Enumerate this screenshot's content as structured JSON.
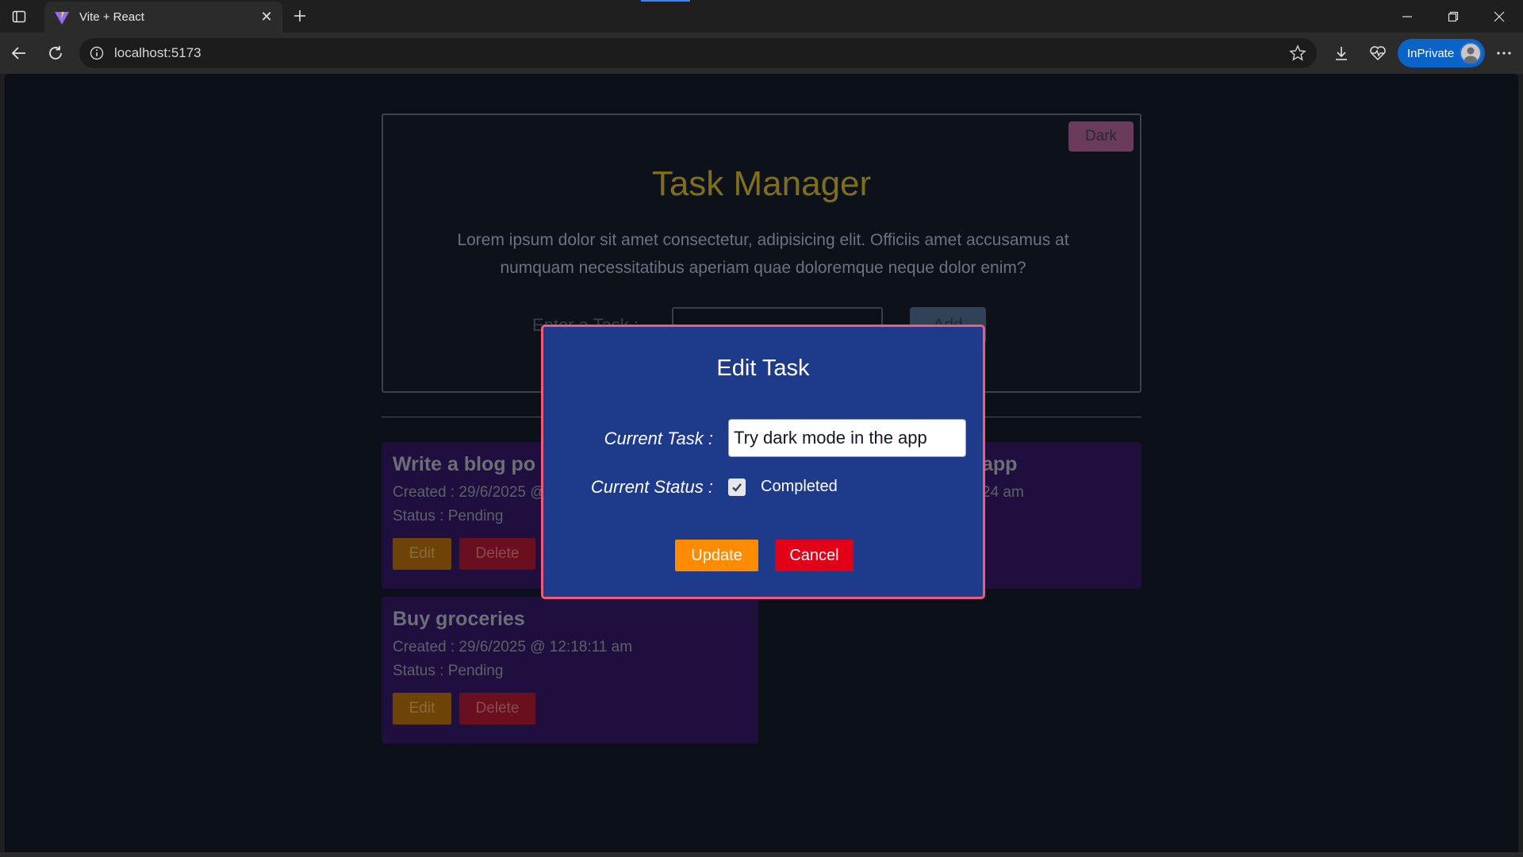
{
  "browser": {
    "tab_title": "Vite + React",
    "url": "localhost:5173",
    "inprivate_label": "InPrivate"
  },
  "app": {
    "theme_toggle_label": "Dark",
    "title": "Task Manager",
    "description": "Lorem ipsum dolor sit amet consectetur, adipisicing elit. Officiis amet accusamus at numquam necessitatibus aperiam quae doloremque neque dolor enim?",
    "task_label": "Enter a Task :",
    "add_label": "Add"
  },
  "tasks": [
    {
      "title": "Write a blog po",
      "created": "Created : 29/6/2025 @",
      "status": "Status : Pending",
      "edit_label": "Edit",
      "delete_label": "Delete"
    },
    {
      "title": "app",
      "created": "24 am"
    },
    {
      "title": "Buy groceries",
      "created": "Created : 29/6/2025 @ 12:18:11 am",
      "status": "Status : Pending",
      "edit_label": "Edit",
      "delete_label": "Delete"
    }
  ],
  "modal": {
    "title": "Edit Task",
    "task_label": "Current Task :",
    "task_value": "Try dark mode in the app",
    "status_label": "Current Status :",
    "status_checked": true,
    "checkbox_label": "Completed",
    "update_label": "Update",
    "cancel_label": "Cancel"
  }
}
